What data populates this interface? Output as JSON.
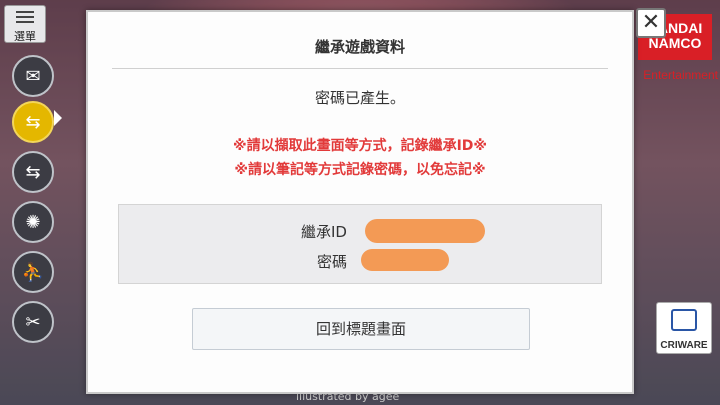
{
  "menu": {
    "label": "選單"
  },
  "sidebar": {
    "items": [
      {
        "icon": "mail-icon",
        "glyph": "✉"
      },
      {
        "icon": "transfer-icon",
        "glyph": "⇆"
      },
      {
        "icon": "device-transfer-icon",
        "glyph": "⇆"
      },
      {
        "icon": "spin-icon",
        "glyph": "✺"
      },
      {
        "icon": "profile-icon",
        "glyph": "⛹"
      },
      {
        "icon": "tools-icon",
        "glyph": "✂"
      }
    ]
  },
  "dialog": {
    "title": "繼承遊戲資料",
    "message": "密碼已產生。",
    "warning1": "※請以擷取此畫面等方式，記錄繼承ID※",
    "warning2": "※請以筆記等方式記錄密碼，以免忘記※",
    "id_label": "繼承ID",
    "password_label": "密碼",
    "return_button": "回到標題畫面",
    "close_glyph": "✕"
  },
  "logos": {
    "bandai_line1": "BANDAI",
    "bandai_line2": "NAMCO",
    "bandai_sub": "Entertainment",
    "criware": "CRIWARE"
  },
  "footer": {
    "credit": "illustrated by agee"
  },
  "colors": {
    "warning": "#e23a3a",
    "redaction": "#f39a55",
    "active_tab": "#e4b700"
  }
}
